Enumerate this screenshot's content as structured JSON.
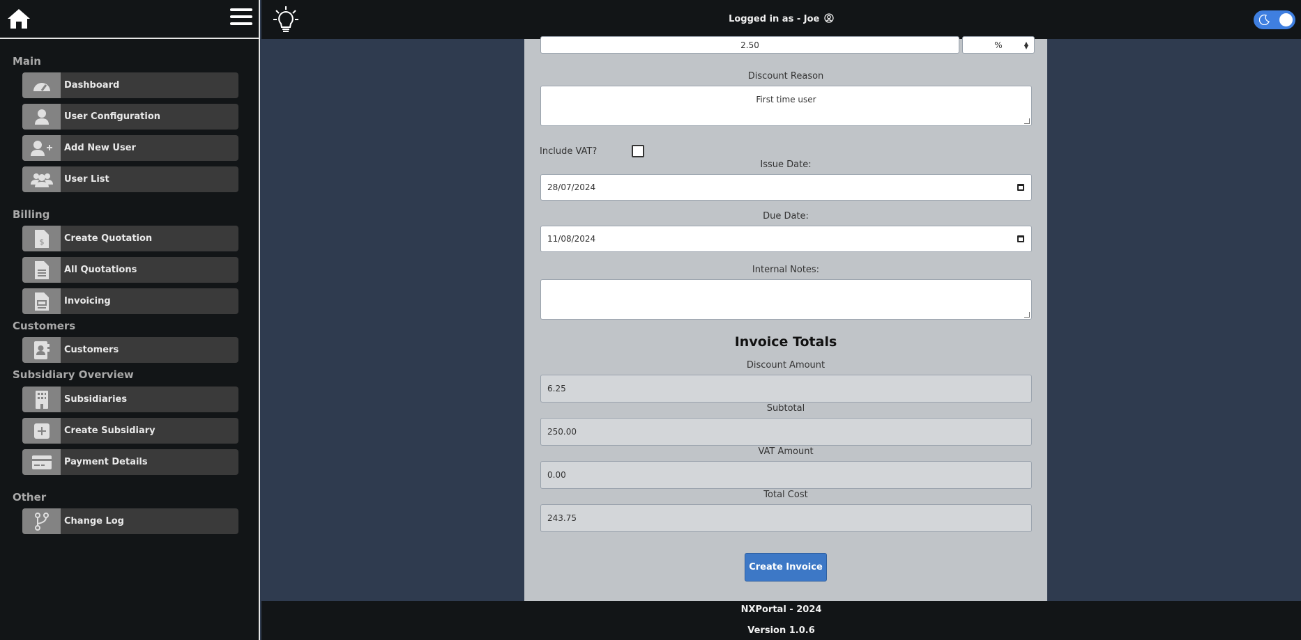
{
  "header": {
    "logged_in_text": "Logged in as - Joe"
  },
  "sidebar": {
    "sections": {
      "main": "Main",
      "billing": "Billing",
      "customers": "Customers",
      "subsidiary": "Subsidiary Overview",
      "other": "Other"
    },
    "items": [
      {
        "label": "Dashboard",
        "icon": "gauge-icon"
      },
      {
        "label": "User Configuration",
        "icon": "user-icon"
      },
      {
        "label": "Add New User",
        "icon": "user-plus-icon"
      },
      {
        "label": "User List",
        "icon": "users-icon"
      },
      {
        "label": "Create Quotation",
        "icon": "file-dollar-icon"
      },
      {
        "label": "All Quotations",
        "icon": "file-lines-icon"
      },
      {
        "label": "Invoicing",
        "icon": "file-invoice-icon"
      },
      {
        "label": "Customers",
        "icon": "address-book-icon"
      },
      {
        "label": "Subsidiaries",
        "icon": "building-icon"
      },
      {
        "label": "Create Subsidiary",
        "icon": "plus-square-icon"
      },
      {
        "label": "Payment Details",
        "icon": "credit-card-icon"
      },
      {
        "label": "Change Log",
        "icon": "code-branch-icon"
      }
    ]
  },
  "form": {
    "discount_value": "2.50",
    "discount_unit": "%",
    "discount_reason_label": "Discount Reason",
    "discount_reason_value": "First time user",
    "include_vat_label": "Include VAT?",
    "include_vat_checked": false,
    "issue_date_label": "Issue Date:",
    "issue_date_value": "28/07/2024",
    "due_date_label": "Due Date:",
    "due_date_value": "11/08/2024",
    "internal_notes_label": "Internal Notes:",
    "internal_notes_value": ""
  },
  "totals": {
    "heading": "Invoice Totals",
    "discount_amount_label": "Discount Amount",
    "discount_amount_value": "6.25",
    "subtotal_label": "Subtotal",
    "subtotal_value": "250.00",
    "vat_amount_label": "VAT Amount",
    "vat_amount_value": "0.00",
    "total_cost_label": "Total Cost",
    "total_cost_value": "243.75",
    "create_button_label": "Create Invoice"
  },
  "footer": {
    "line1": "NXPortal - 2024",
    "line2": "Version 1.0.6"
  },
  "colors": {
    "accent": "#3d78c6",
    "toggle": "#3f7fe0",
    "sidebar_bg": "#121517",
    "main_bg": "#2f3b4f"
  }
}
